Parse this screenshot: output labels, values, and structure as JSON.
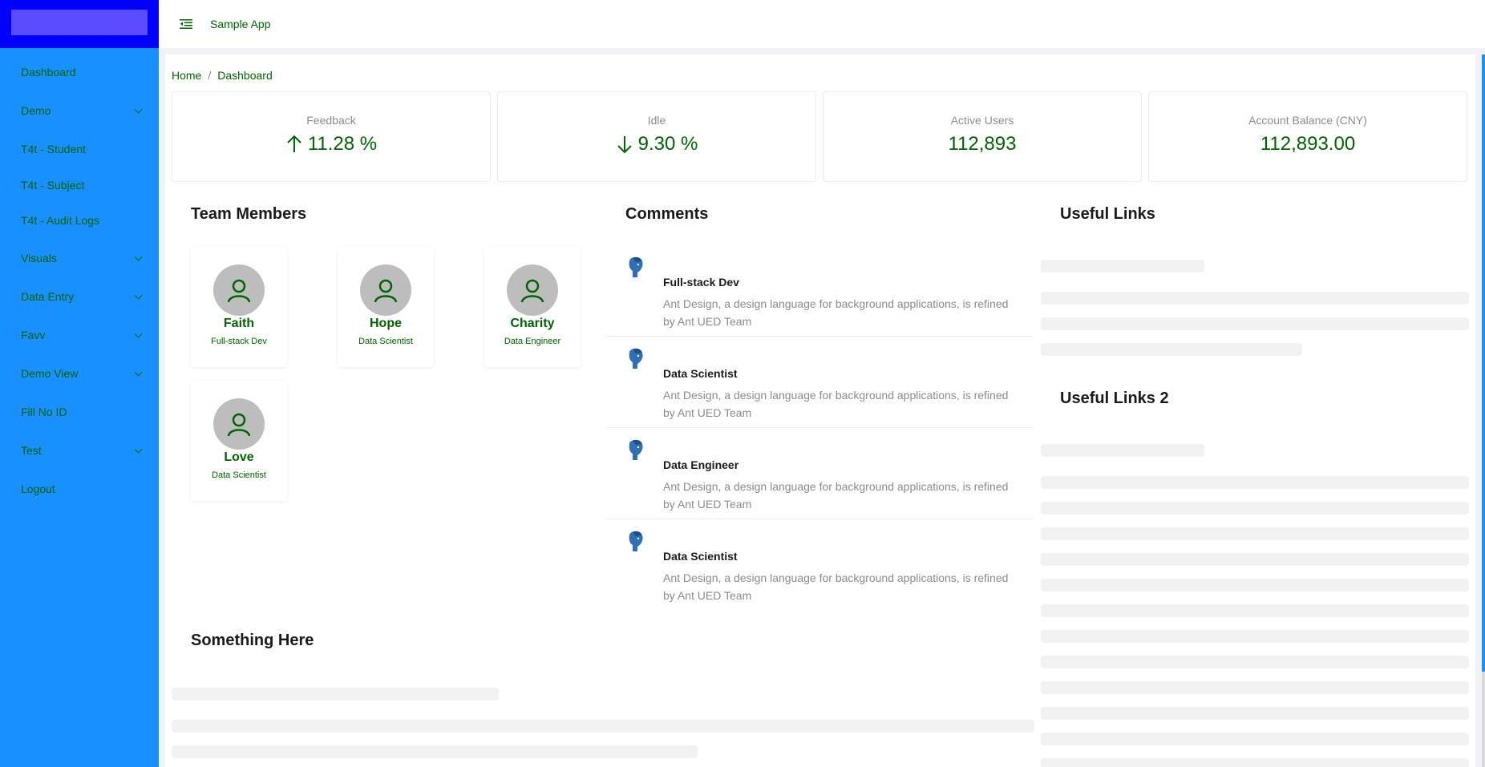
{
  "sidebar": {
    "items": [
      {
        "label": "Dashboard",
        "has_children": false
      },
      {
        "label": "Demo",
        "has_children": true
      },
      {
        "label": "T4t - Student",
        "has_children": false
      },
      {
        "label": "T4t - Subject",
        "has_children": false
      },
      {
        "label": "T4t - Audit Logs",
        "has_children": false
      },
      {
        "label": "Visuals",
        "has_children": true
      },
      {
        "label": "Data Entry",
        "has_children": true
      },
      {
        "label": "Favv",
        "has_children": true
      },
      {
        "label": "Demo View",
        "has_children": true
      },
      {
        "label": "Fill No ID",
        "has_children": false
      },
      {
        "label": "Test",
        "has_children": true
      },
      {
        "label": "Logout",
        "has_children": false
      }
    ]
  },
  "header": {
    "app_title": "Sample App",
    "menu_fold_icon": "menu-fold-icon"
  },
  "breadcrumb": {
    "home": "Home",
    "separator": "/",
    "current": "Dashboard"
  },
  "stats": [
    {
      "title": "Feedback",
      "value": "11.28 %",
      "trend": "up"
    },
    {
      "title": "Idle",
      "value": "9.30 %",
      "trend": "down"
    },
    {
      "title": "Active Users",
      "value": "112,893"
    },
    {
      "title": "Account Balance (CNY)",
      "value": "112,893.00"
    }
  ],
  "team": {
    "title": "Team Members",
    "members": [
      {
        "name": "Faith",
        "role": "Full-stack Dev"
      },
      {
        "name": "Hope",
        "role": "Data Scientist"
      },
      {
        "name": "Charity",
        "role": "Data Engineer"
      },
      {
        "name": "Love",
        "role": "Data Scientist"
      }
    ]
  },
  "comments": {
    "title": "Comments",
    "items": [
      {
        "author": "Full-stack Dev",
        "text": "Ant Design, a design language for background applications, is refined by Ant UED Team"
      },
      {
        "author": "Data Scientist",
        "text": "Ant Design, a design language for background applications, is refined by Ant UED Team"
      },
      {
        "author": "Data Engineer",
        "text": "Ant Design, a design language for background applications, is refined by Ant UED Team"
      },
      {
        "author": "Data Scientist",
        "text": "Ant Design, a design language for background applications, is refined by Ant UED Team"
      }
    ]
  },
  "links": {
    "title": "Useful Links",
    "title2": "Useful Links 2"
  },
  "something": {
    "title": "Something Here"
  },
  "colors": {
    "sidebar_bg": "#1890ff",
    "logo_area": "#0000ff",
    "text_green": "#006400",
    "muted": "#8c8c8c"
  }
}
